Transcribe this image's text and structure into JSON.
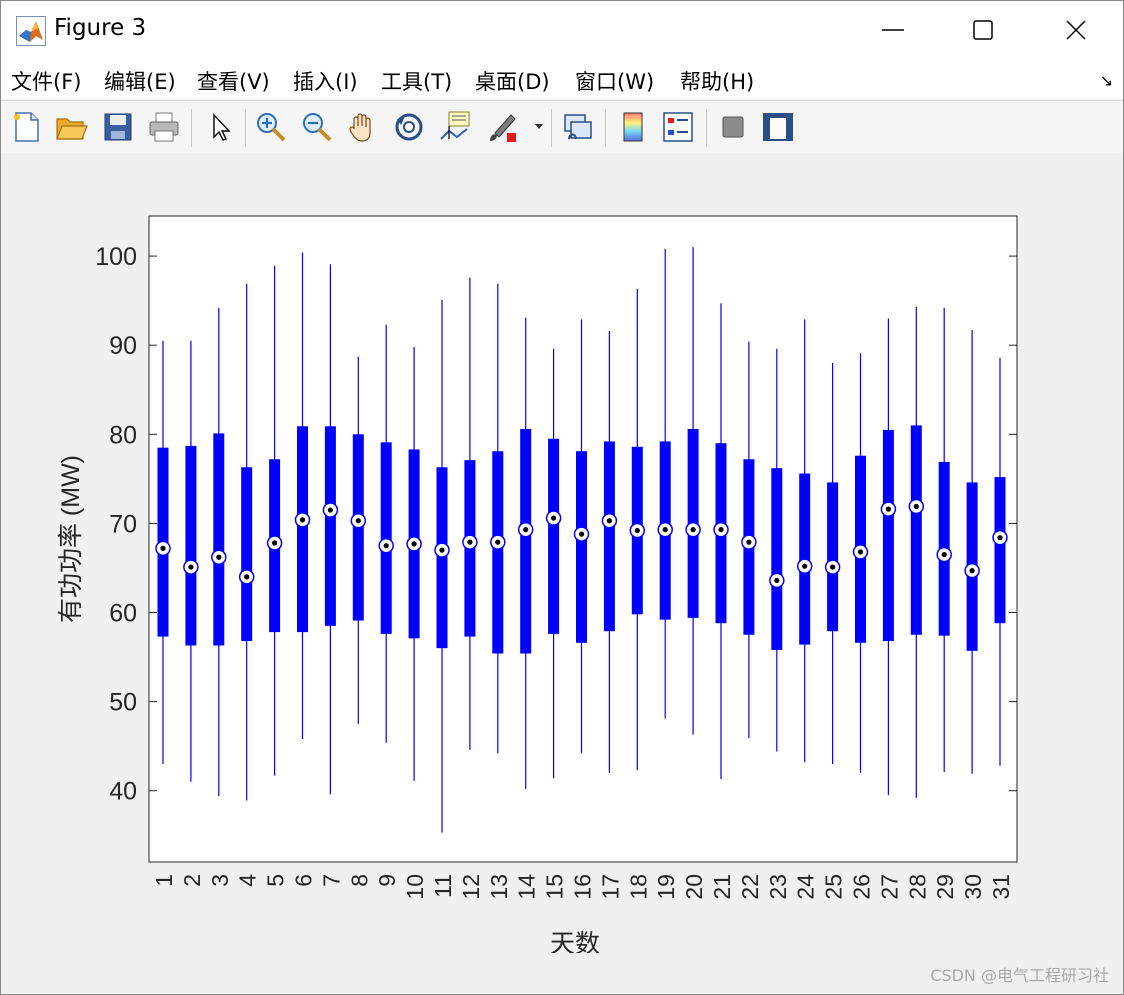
{
  "window": {
    "title": "Figure 3"
  },
  "menu": {
    "items": [
      "文件(F)",
      "编辑(E)",
      "查看(V)",
      "插入(I)",
      "工具(T)",
      "桌面(D)",
      "窗口(W)",
      "帮助(H)"
    ]
  },
  "toolbar": {
    "buttons": [
      {
        "name": "new-figure-icon"
      },
      {
        "name": "open-file-icon"
      },
      {
        "name": "save-icon"
      },
      {
        "name": "print-icon"
      },
      {
        "name": "pointer-icon"
      },
      {
        "name": "zoom-in-icon"
      },
      {
        "name": "zoom-out-icon"
      },
      {
        "name": "pan-hand-icon"
      },
      {
        "name": "rotate-3d-icon"
      },
      {
        "name": "data-cursor-icon"
      },
      {
        "name": "brush-icon"
      },
      {
        "name": "link-plot-icon"
      },
      {
        "name": "colorbar-icon"
      },
      {
        "name": "legend-icon"
      },
      {
        "name": "hide-plot-tools-icon"
      },
      {
        "name": "show-plot-tools-icon"
      }
    ]
  },
  "chart_data": {
    "type": "box",
    "title": "",
    "xlabel": "天数",
    "ylabel": "有功功率 (MW)",
    "ylim": [
      32,
      104.5
    ],
    "yticks": [
      40,
      50,
      60,
      70,
      80,
      90,
      100
    ],
    "categories": [
      "1",
      "2",
      "3",
      "4",
      "5",
      "6",
      "7",
      "8",
      "9",
      "10",
      "11",
      "12",
      "13",
      "14",
      "15",
      "16",
      "17",
      "18",
      "19",
      "20",
      "21",
      "22",
      "23",
      "24",
      "25",
      "26",
      "27",
      "28",
      "29",
      "30",
      "31"
    ],
    "boxes": [
      {
        "min": 43.0,
        "q1": 57.3,
        "median": 67.2,
        "q3": 78.5,
        "max": 90.5
      },
      {
        "min": 41.0,
        "q1": 56.3,
        "median": 65.1,
        "q3": 78.7,
        "max": 90.5
      },
      {
        "min": 39.4,
        "q1": 56.3,
        "median": 66.2,
        "q3": 80.1,
        "max": 94.2
      },
      {
        "min": 38.9,
        "q1": 56.8,
        "median": 64.0,
        "q3": 76.3,
        "max": 96.9
      },
      {
        "min": 41.7,
        "q1": 57.8,
        "median": 67.8,
        "q3": 77.2,
        "max": 98.9
      },
      {
        "min": 45.8,
        "q1": 57.8,
        "median": 70.4,
        "q3": 80.9,
        "max": 100.4
      },
      {
        "min": 39.6,
        "q1": 58.5,
        "median": 71.5,
        "q3": 80.9,
        "max": 99.1
      },
      {
        "min": 47.5,
        "q1": 59.1,
        "median": 70.3,
        "q3": 80.0,
        "max": 88.7
      },
      {
        "min": 45.4,
        "q1": 57.6,
        "median": 67.5,
        "q3": 79.1,
        "max": 92.3
      },
      {
        "min": 41.1,
        "q1": 57.1,
        "median": 67.7,
        "q3": 78.3,
        "max": 89.8
      },
      {
        "min": 35.3,
        "q1": 56.0,
        "median": 67.0,
        "q3": 76.3,
        "max": 95.1
      },
      {
        "min": 44.6,
        "q1": 57.3,
        "median": 67.9,
        "q3": 77.1,
        "max": 97.6
      },
      {
        "min": 44.2,
        "q1": 55.4,
        "median": 67.9,
        "q3": 78.1,
        "max": 96.9
      },
      {
        "min": 40.2,
        "q1": 55.4,
        "median": 69.3,
        "q3": 80.6,
        "max": 93.1
      },
      {
        "min": 41.4,
        "q1": 57.6,
        "median": 70.6,
        "q3": 79.5,
        "max": 89.6
      },
      {
        "min": 44.2,
        "q1": 56.6,
        "median": 68.8,
        "q3": 78.1,
        "max": 92.9
      },
      {
        "min": 42.0,
        "q1": 57.9,
        "median": 70.3,
        "q3": 79.2,
        "max": 91.6
      },
      {
        "min": 42.3,
        "q1": 59.8,
        "median": 69.2,
        "q3": 78.6,
        "max": 96.3
      },
      {
        "min": 48.1,
        "q1": 59.2,
        "median": 69.3,
        "q3": 79.2,
        "max": 100.8
      },
      {
        "min": 46.3,
        "q1": 59.4,
        "median": 69.3,
        "q3": 80.6,
        "max": 101.0
      },
      {
        "min": 41.3,
        "q1": 58.8,
        "median": 69.3,
        "q3": 79.0,
        "max": 94.7
      },
      {
        "min": 45.9,
        "q1": 57.5,
        "median": 67.9,
        "q3": 77.2,
        "max": 90.4
      },
      {
        "min": 44.4,
        "q1": 55.8,
        "median": 63.6,
        "q3": 76.2,
        "max": 89.6
      },
      {
        "min": 43.2,
        "q1": 56.4,
        "median": 65.2,
        "q3": 75.6,
        "max": 92.9
      },
      {
        "min": 43.0,
        "q1": 57.9,
        "median": 65.1,
        "q3": 74.6,
        "max": 88.0
      },
      {
        "min": 42.0,
        "q1": 56.6,
        "median": 66.8,
        "q3": 77.6,
        "max": 89.1
      },
      {
        "min": 39.5,
        "q1": 56.8,
        "median": 71.6,
        "q3": 80.5,
        "max": 93.0
      },
      {
        "min": 39.2,
        "q1": 57.5,
        "median": 71.9,
        "q3": 81.0,
        "max": 94.3
      },
      {
        "min": 42.1,
        "q1": 57.4,
        "median": 66.5,
        "q3": 76.9,
        "max": 94.2
      },
      {
        "min": 41.9,
        "q1": 55.7,
        "median": 64.7,
        "q3": 74.6,
        "max": 91.7
      },
      {
        "min": 42.8,
        "q1": 58.8,
        "median": 68.4,
        "q3": 75.2,
        "max": 88.6
      }
    ],
    "box_color": "#0000ff",
    "grid": false
  },
  "watermark": "CSDN @电气工程研习社"
}
